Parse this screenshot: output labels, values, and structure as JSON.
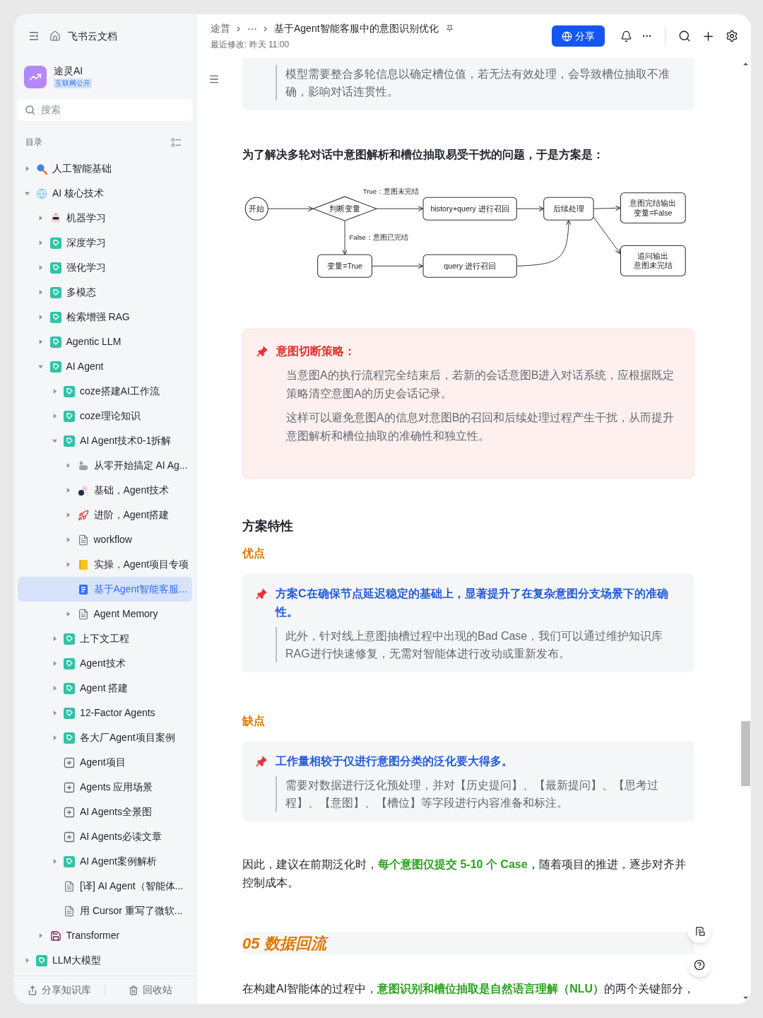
{
  "sidebar": {
    "app_title": "飞书云文档",
    "workspace": {
      "name": "途灵AI",
      "badge": "互联网公开"
    },
    "search": {
      "placeholder": "搜索"
    },
    "toc_label": "目录",
    "tree": [
      {
        "label": "人工智能基础",
        "kind": "magnifier",
        "expanded": false,
        "selected": false
      },
      {
        "label": "AI 核心技术",
        "kind": "globe",
        "expanded": true,
        "selected": false,
        "children": [
          {
            "label": "机器学习",
            "kind": "robot",
            "expanded": false,
            "selected": false
          },
          {
            "label": "深度学习",
            "kind": "tag",
            "expanded": false,
            "selected": false
          },
          {
            "label": "强化学习",
            "kind": "tag",
            "expanded": false,
            "selected": false
          },
          {
            "label": "多模态",
            "kind": "tag",
            "expanded": false,
            "selected": false
          },
          {
            "label": "检索增强 RAG",
            "kind": "tag",
            "expanded": false,
            "selected": false
          },
          {
            "label": "Agentic LLM",
            "kind": "tag",
            "expanded": false,
            "selected": false
          },
          {
            "label": "AI Agent",
            "kind": "tag",
            "expanded": true,
            "selected": false,
            "children": [
              {
                "label": "coze搭建AI工作流",
                "kind": "tag",
                "expanded": false,
                "selected": false
              },
              {
                "label": "coze理论知识",
                "kind": "tag",
                "expanded": false,
                "selected": false
              },
              {
                "label": "AI Agent技术0-1拆解",
                "kind": "tag",
                "expanded": true,
                "selected": false,
                "children": [
                  {
                    "label": "从零开始搞定 AI Ag...",
                    "kind": "hand",
                    "expanded": false,
                    "selected": false
                  },
                  {
                    "label": "基础，Agent技术",
                    "kind": "balls",
                    "expanded": false,
                    "selected": false
                  },
                  {
                    "label": "进阶，Agent搭建",
                    "kind": "rocket",
                    "expanded": false,
                    "selected": false
                  },
                  {
                    "label": "workflow",
                    "kind": "doc",
                    "expanded": false,
                    "selected": false
                  },
                  {
                    "label": "实操，Agent项目专项",
                    "kind": "notebook",
                    "expanded": false,
                    "selected": false
                  },
                  {
                    "label": "基于Agent智能客服...",
                    "kind": "doc",
                    "selected": true
                  },
                  {
                    "label": "Agent Memory",
                    "kind": "doc",
                    "expanded": false,
                    "selected": false
                  }
                ]
              },
              {
                "label": "上下文工程",
                "kind": "tag",
                "expanded": false,
                "selected": false
              },
              {
                "label": "Agent技术",
                "kind": "tag",
                "expanded": false,
                "selected": false
              },
              {
                "label": "Agent 搭建",
                "kind": "tag",
                "expanded": false,
                "selected": false
              },
              {
                "label": "12-Factor Agents",
                "kind": "tag",
                "expanded": false,
                "selected": false
              },
              {
                "label": "各大厂Agent项目案例",
                "kind": "tag",
                "expanded": false,
                "selected": false
              },
              {
                "label": "Agent项目",
                "kind": "board",
                "selected": false
              },
              {
                "label": "Agents 应用场景",
                "kind": "board",
                "selected": false
              },
              {
                "label": "AI Agents全景图",
                "kind": "board",
                "selected": false
              },
              {
                "label": "AI Agents必读文章",
                "kind": "board",
                "selected": false
              },
              {
                "label": "AI Agent案例解析",
                "kind": "tag",
                "expanded": false,
                "selected": false
              },
              {
                "label": "[译] AI Agent（智能体...",
                "kind": "doc",
                "selected": false
              },
              {
                "label": "用 Cursor 重写了微软...",
                "kind": "doc",
                "selected": false
              }
            ]
          },
          {
            "label": "Transformer",
            "kind": "floppy",
            "expanded": false,
            "selected": false
          }
        ]
      },
      {
        "label": "LLM大模型",
        "kind": "tag",
        "expanded": false,
        "selected": false
      }
    ],
    "footer": [
      "分享知识库",
      "回收站"
    ]
  },
  "header": {
    "breadcrumb": [
      "途普",
      "···",
      "基于Agent智能客服中的意图识别优化"
    ],
    "modified": "最近修改: 昨天 11:00",
    "share_button": "分享",
    "more": "···"
  },
  "document": [
    {
      "kind": "callout",
      "body": [
        {
          "kind": "quote",
          "text": "模型需要整合多轮信息以确定槽位值，若无法有效处理，会导致槽位抽取不准确，影响对话连贯性。"
        }
      ]
    },
    {
      "kind": "bold_paragraph",
      "text": "为了解决多轮对话中意图解析和槽位抽取易受干扰的问题，于是方案是："
    },
    {
      "kind": "flowchart",
      "nodes": [
        {
          "kind": "start",
          "lines": [
            "开始"
          ]
        },
        {
          "kind": "decision",
          "lines": [
            "判断变量"
          ]
        },
        {
          "kind": "process",
          "lines": [
            "history+query 进行召回"
          ]
        },
        {
          "kind": "process",
          "lines": [
            "后续处理"
          ]
        },
        {
          "kind": "process",
          "lines": [
            "意图完结输出",
            "变量=False"
          ]
        },
        {
          "kind": "process",
          "lines": [
            "变量=True"
          ]
        },
        {
          "kind": "process",
          "lines": [
            "query 进行召回"
          ]
        },
        {
          "kind": "process",
          "lines": [
            "追问输出",
            "意图未完结"
          ]
        }
      ],
      "edge_labels": [
        "True：意图未完结",
        "False：意图已完结"
      ]
    },
    {
      "kind": "alert_callout",
      "title": "意图切断策略：",
      "body": [
        {
          "kind": "text",
          "text": "当意图A的执行流程完全结束后，若新的会话意图B进入对话系统，应根据既定策略清空意图A的历史会话记录。"
        },
        {
          "kind": "text",
          "text": "这样可以避免意图A的信息对意图B的召回和后续处理过程产生干扰，从而提升意图解析和槽位抽取的准确性和独立性。"
        }
      ]
    },
    {
      "kind": "heading",
      "text": "方案特性"
    },
    {
      "kind": "label",
      "text": "优点"
    },
    {
      "kind": "callout",
      "title": "方案C在确保节点延迟稳定的基础上，显著提升了在复杂意图分支场景下的准确性。",
      "body": [
        {
          "kind": "quote",
          "text": "此外，针对线上意图抽槽过程中出现的Bad Case，我们可以通过维护知识库RAG进行快速修复，无需对智能体进行改动或重新发布。"
        }
      ]
    },
    {
      "kind": "label",
      "text": "缺点"
    },
    {
      "kind": "callout",
      "title": "工作量相较于仅进行意图分类的泛化要大得多。",
      "body": [
        {
          "kind": "quote",
          "text": "需要对数据进行泛化预处理，并对【历史提问】、【最新提问】、【思考过程】、【意图】、【槽位】等字段进行内容准备和标注。"
        }
      ]
    },
    {
      "kind": "paragraph",
      "text": "因此，建议在前期泛化时，**每个意图仅提交 5-10 个 Case，**随着项目的推进，逐步对齐并控制成本。"
    },
    {
      "kind": "section_heading",
      "text": "05 数据回流"
    },
    {
      "kind": "paragraph",
      "text": "在构建AI智能体的过程中，**意图识别和槽位抽取是自然语言理解（NLU）**的两个关键部分，"
    }
  ]
}
